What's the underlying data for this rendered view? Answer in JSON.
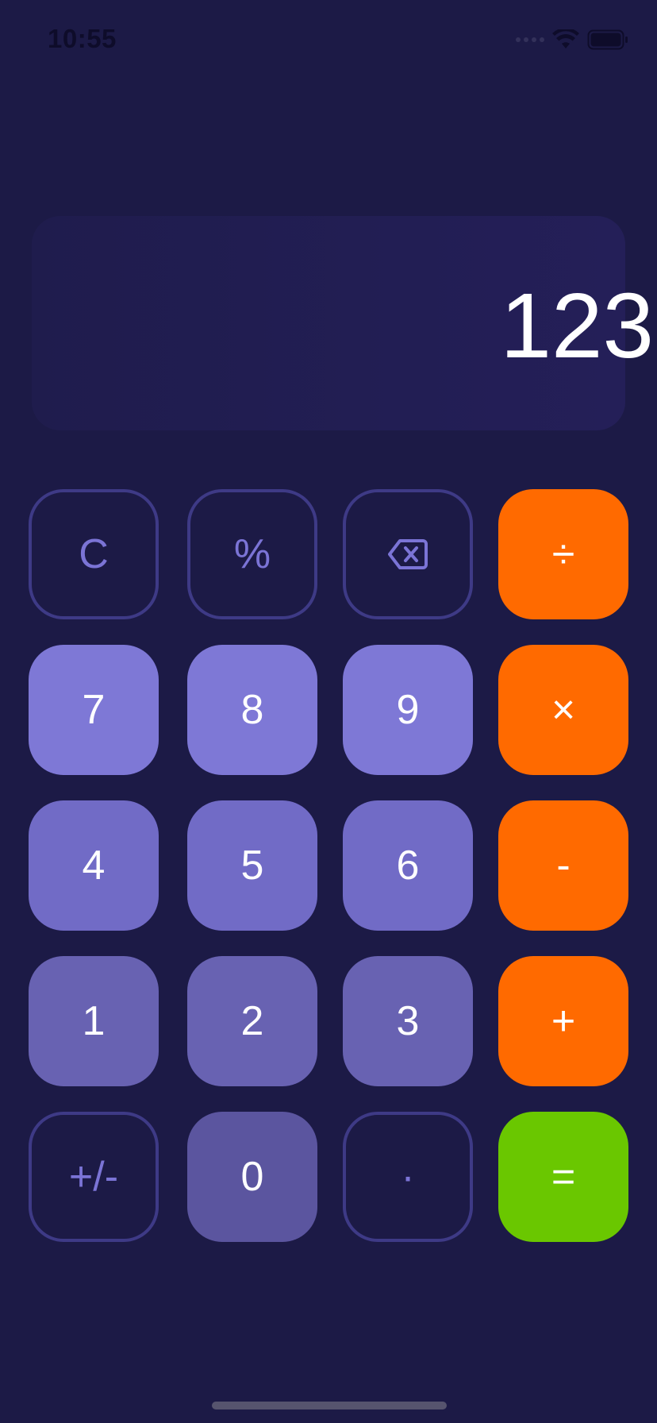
{
  "status_bar": {
    "time": "10:55"
  },
  "display": {
    "value": "123"
  },
  "keys": {
    "clear": "C",
    "percent": "%",
    "backspace": "",
    "divide": "÷",
    "seven": "7",
    "eight": "8",
    "nine": "9",
    "multiply": "×",
    "four": "4",
    "five": "5",
    "six": "6",
    "subtract": "-",
    "one": "1",
    "two": "2",
    "three": "3",
    "add": "+",
    "sign": "+/-",
    "zero": "0",
    "decimal": "·",
    "equals": "="
  },
  "colors": {
    "background": "#1c1a46",
    "operator": "#ff6a00",
    "equals": "#6ac700",
    "digit_light": "#7e78d6",
    "outline": "#3e3a86"
  }
}
